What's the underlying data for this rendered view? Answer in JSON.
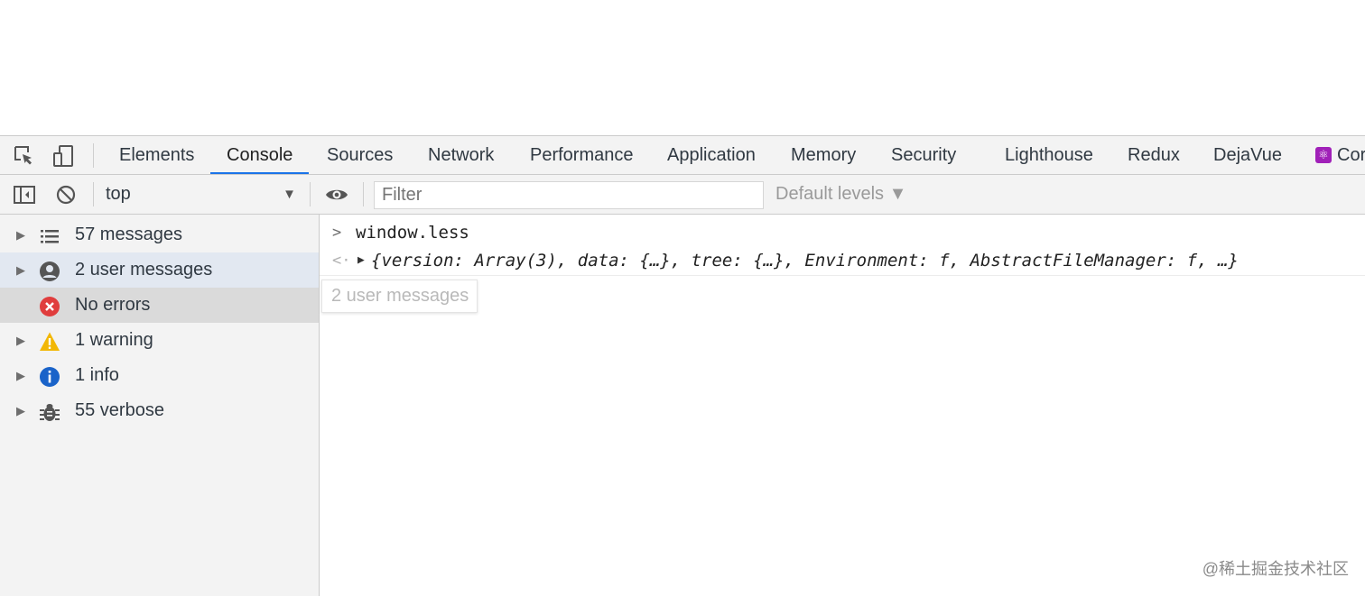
{
  "tabs": [
    {
      "label": "Elements",
      "active": false
    },
    {
      "label": "Console",
      "active": true
    },
    {
      "label": "Sources",
      "active": false
    },
    {
      "label": "Network",
      "active": false
    },
    {
      "label": "Performance",
      "active": false
    },
    {
      "label": "Application",
      "active": false
    },
    {
      "label": "Memory",
      "active": false
    },
    {
      "label": "Security",
      "active": false
    },
    {
      "label": "Lighthouse",
      "active": false
    },
    {
      "label": "Redux",
      "active": false
    },
    {
      "label": "DejaVue",
      "active": false
    },
    {
      "label": "Cor",
      "active": false
    }
  ],
  "toolbar": {
    "context": "top",
    "filter_placeholder": "Filter",
    "levels": "Default levels ▼"
  },
  "sidebar": {
    "items": [
      {
        "label": "57 messages",
        "icon": "list-icon"
      },
      {
        "label": "2 user messages",
        "icon": "user-icon"
      },
      {
        "label": "No errors",
        "icon": "error-icon"
      },
      {
        "label": "1 warning",
        "icon": "warning-icon"
      },
      {
        "label": "1 info",
        "icon": "info-icon"
      },
      {
        "label": "55 verbose",
        "icon": "bug-icon"
      }
    ]
  },
  "console": {
    "input": "window.less",
    "result": "{version: Array(3), data: {…}, tree: {…}, Environment: f, AbstractFileManager: f, …}",
    "tooltip": "2 user messages"
  },
  "watermark": "@稀土掘金技术社区",
  "colors": {
    "accent": "#1a73e8",
    "error": "#e03d3d",
    "warning": "#f2b705",
    "info": "#1a63c9",
    "react_badge": "#a020b8"
  }
}
